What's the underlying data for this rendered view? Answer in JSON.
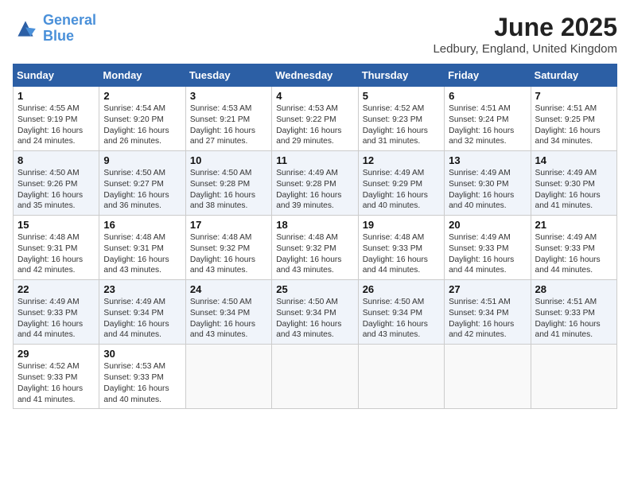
{
  "header": {
    "logo_line1": "General",
    "logo_line2": "Blue",
    "month_title": "June 2025",
    "location": "Ledbury, England, United Kingdom"
  },
  "weekdays": [
    "Sunday",
    "Monday",
    "Tuesday",
    "Wednesday",
    "Thursday",
    "Friday",
    "Saturday"
  ],
  "weeks": [
    [
      {
        "day": "1",
        "sunrise": "4:55 AM",
        "sunset": "9:19 PM",
        "daylight": "16 hours and 24 minutes."
      },
      {
        "day": "2",
        "sunrise": "4:54 AM",
        "sunset": "9:20 PM",
        "daylight": "16 hours and 26 minutes."
      },
      {
        "day": "3",
        "sunrise": "4:53 AM",
        "sunset": "9:21 PM",
        "daylight": "16 hours and 27 minutes."
      },
      {
        "day": "4",
        "sunrise": "4:53 AM",
        "sunset": "9:22 PM",
        "daylight": "16 hours and 29 minutes."
      },
      {
        "day": "5",
        "sunrise": "4:52 AM",
        "sunset": "9:23 PM",
        "daylight": "16 hours and 31 minutes."
      },
      {
        "day": "6",
        "sunrise": "4:51 AM",
        "sunset": "9:24 PM",
        "daylight": "16 hours and 32 minutes."
      },
      {
        "day": "7",
        "sunrise": "4:51 AM",
        "sunset": "9:25 PM",
        "daylight": "16 hours and 34 minutes."
      }
    ],
    [
      {
        "day": "8",
        "sunrise": "4:50 AM",
        "sunset": "9:26 PM",
        "daylight": "16 hours and 35 minutes."
      },
      {
        "day": "9",
        "sunrise": "4:50 AM",
        "sunset": "9:27 PM",
        "daylight": "16 hours and 36 minutes."
      },
      {
        "day": "10",
        "sunrise": "4:50 AM",
        "sunset": "9:28 PM",
        "daylight": "16 hours and 38 minutes."
      },
      {
        "day": "11",
        "sunrise": "4:49 AM",
        "sunset": "9:28 PM",
        "daylight": "16 hours and 39 minutes."
      },
      {
        "day": "12",
        "sunrise": "4:49 AM",
        "sunset": "9:29 PM",
        "daylight": "16 hours and 40 minutes."
      },
      {
        "day": "13",
        "sunrise": "4:49 AM",
        "sunset": "9:30 PM",
        "daylight": "16 hours and 40 minutes."
      },
      {
        "day": "14",
        "sunrise": "4:49 AM",
        "sunset": "9:30 PM",
        "daylight": "16 hours and 41 minutes."
      }
    ],
    [
      {
        "day": "15",
        "sunrise": "4:48 AM",
        "sunset": "9:31 PM",
        "daylight": "16 hours and 42 minutes."
      },
      {
        "day": "16",
        "sunrise": "4:48 AM",
        "sunset": "9:31 PM",
        "daylight": "16 hours and 43 minutes."
      },
      {
        "day": "17",
        "sunrise": "4:48 AM",
        "sunset": "9:32 PM",
        "daylight": "16 hours and 43 minutes."
      },
      {
        "day": "18",
        "sunrise": "4:48 AM",
        "sunset": "9:32 PM",
        "daylight": "16 hours and 43 minutes."
      },
      {
        "day": "19",
        "sunrise": "4:48 AM",
        "sunset": "9:33 PM",
        "daylight": "16 hours and 44 minutes."
      },
      {
        "day": "20",
        "sunrise": "4:49 AM",
        "sunset": "9:33 PM",
        "daylight": "16 hours and 44 minutes."
      },
      {
        "day": "21",
        "sunrise": "4:49 AM",
        "sunset": "9:33 PM",
        "daylight": "16 hours and 44 minutes."
      }
    ],
    [
      {
        "day": "22",
        "sunrise": "4:49 AM",
        "sunset": "9:33 PM",
        "daylight": "16 hours and 44 minutes."
      },
      {
        "day": "23",
        "sunrise": "4:49 AM",
        "sunset": "9:34 PM",
        "daylight": "16 hours and 44 minutes."
      },
      {
        "day": "24",
        "sunrise": "4:50 AM",
        "sunset": "9:34 PM",
        "daylight": "16 hours and 43 minutes."
      },
      {
        "day": "25",
        "sunrise": "4:50 AM",
        "sunset": "9:34 PM",
        "daylight": "16 hours and 43 minutes."
      },
      {
        "day": "26",
        "sunrise": "4:50 AM",
        "sunset": "9:34 PM",
        "daylight": "16 hours and 43 minutes."
      },
      {
        "day": "27",
        "sunrise": "4:51 AM",
        "sunset": "9:34 PM",
        "daylight": "16 hours and 42 minutes."
      },
      {
        "day": "28",
        "sunrise": "4:51 AM",
        "sunset": "9:33 PM",
        "daylight": "16 hours and 41 minutes."
      }
    ],
    [
      {
        "day": "29",
        "sunrise": "4:52 AM",
        "sunset": "9:33 PM",
        "daylight": "16 hours and 41 minutes."
      },
      {
        "day": "30",
        "sunrise": "4:53 AM",
        "sunset": "9:33 PM",
        "daylight": "16 hours and 40 minutes."
      },
      null,
      null,
      null,
      null,
      null
    ]
  ]
}
